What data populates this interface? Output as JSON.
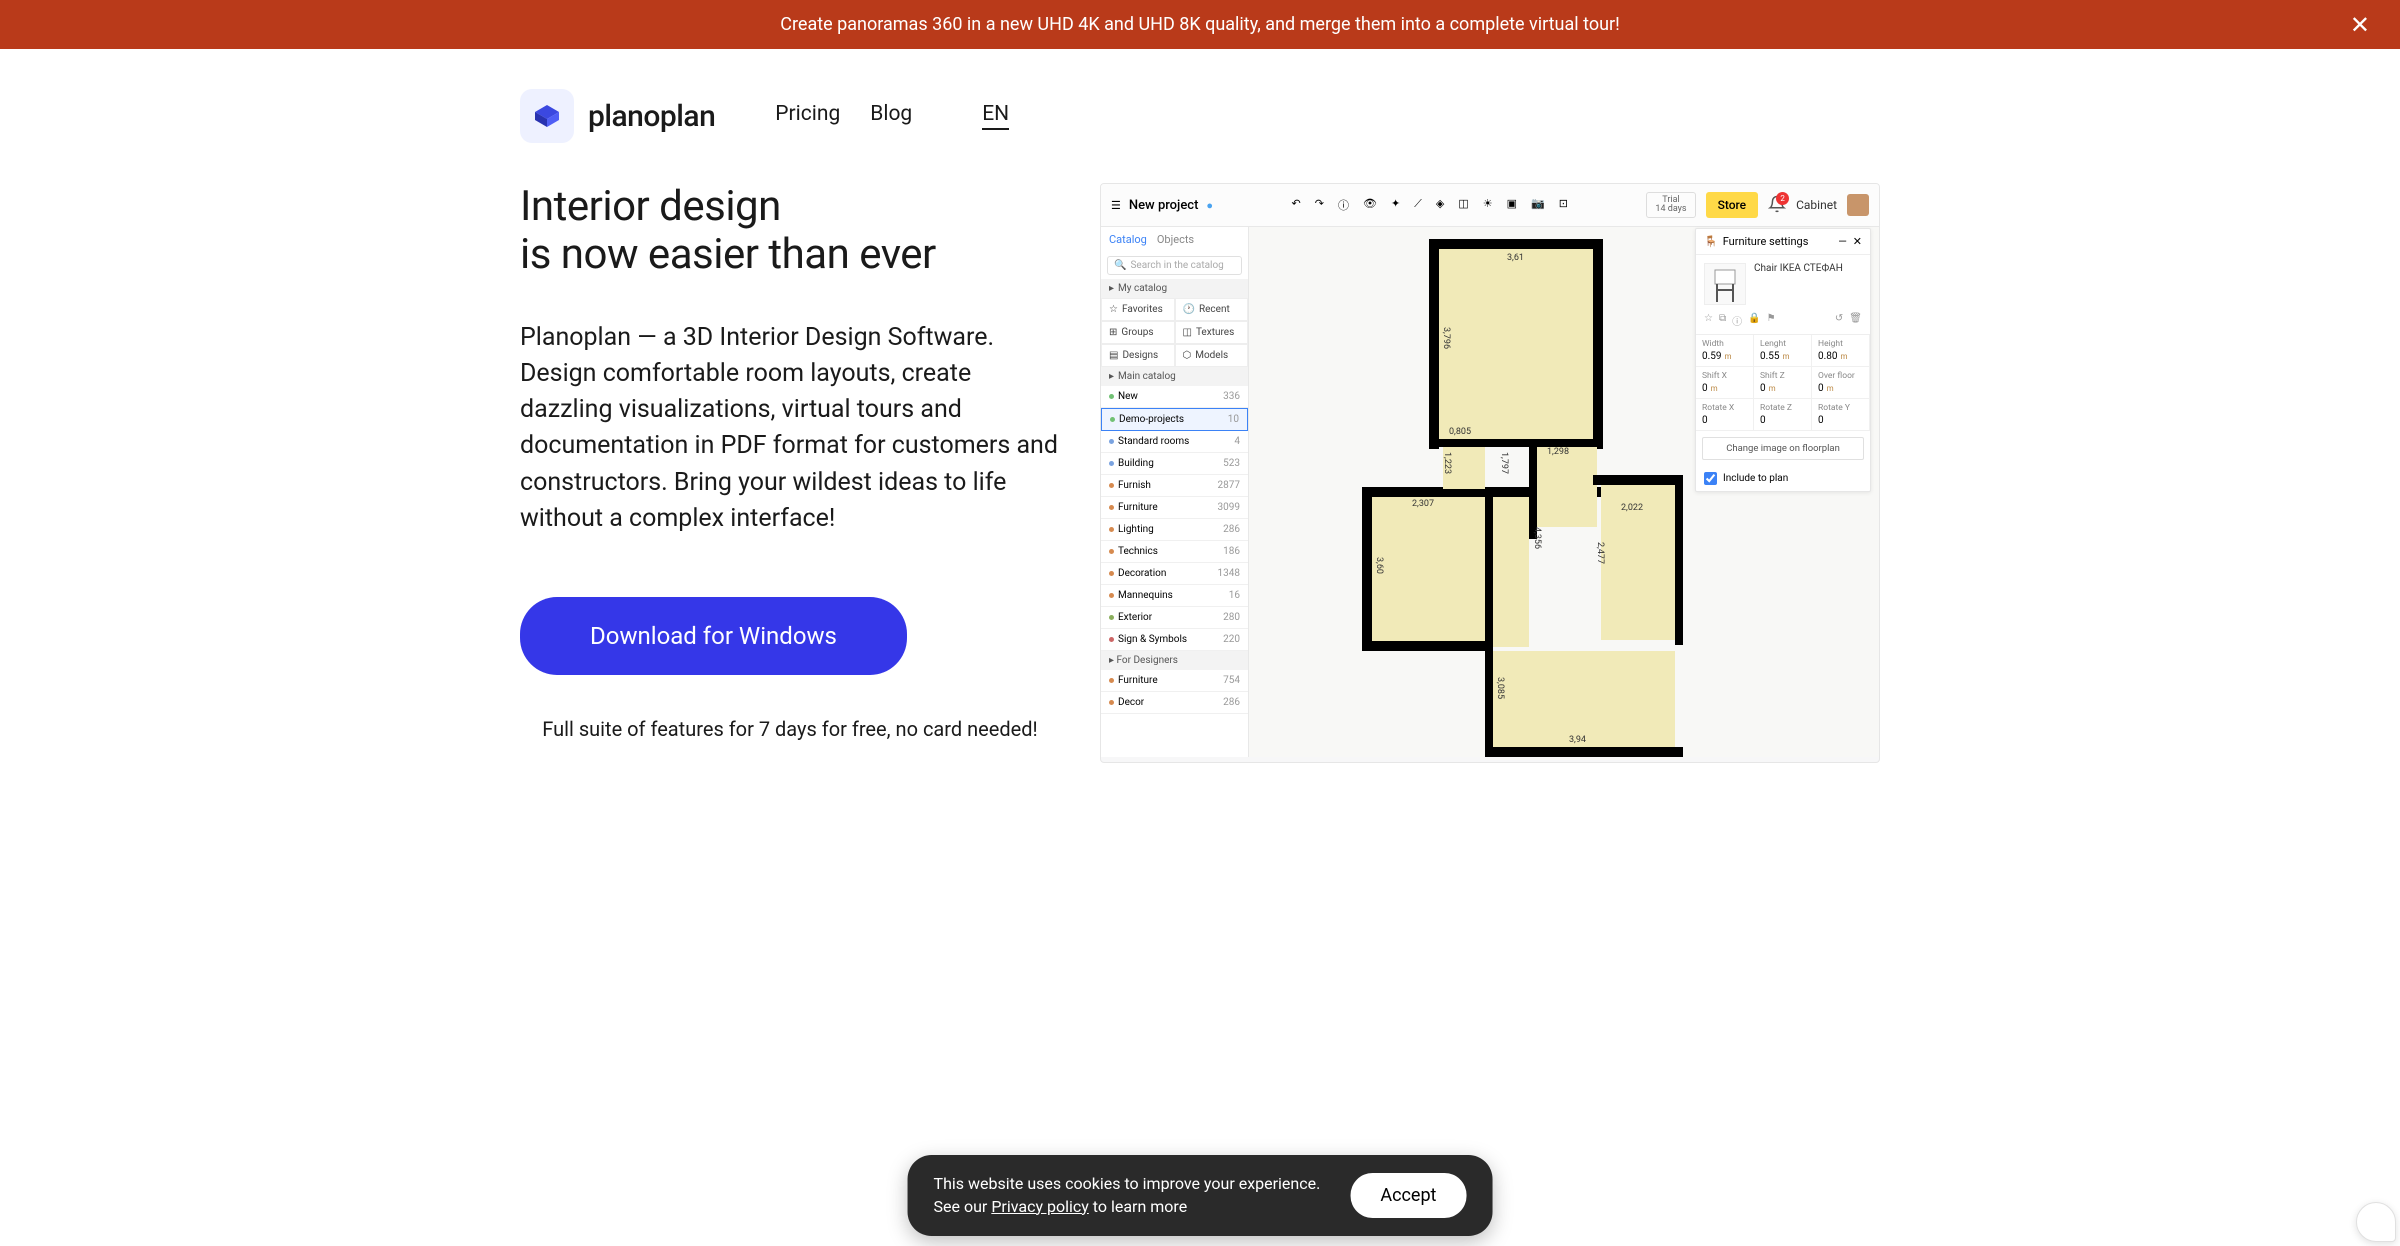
{
  "banner": {
    "text": "Create panoramas 360 in a new UHD 4K and UHD 8K quality, and merge them into a complete virtual tour!"
  },
  "nav": {
    "brand": "planoplan",
    "pricing": "Pricing",
    "blog": "Blog",
    "lang": "EN"
  },
  "hero": {
    "title_l1": "Interior design",
    "title_l2": "is now easier than ever",
    "desc": "Planoplan — a 3D Interior Design Software. Design comfortable room layouts, create dazzling visualizations, virtual tours and documentation in PDF format for customers and constructors. Bring your wildest ideas to life without a complex interface!",
    "cta": "Download for Windows",
    "note": "Full suite of features for 7 days for free, no card needed!"
  },
  "app": {
    "project": "New project",
    "trial_l1": "Trial",
    "trial_l2": "14 days",
    "store": "Store",
    "cabinet": "Cabinet",
    "bell_count": "2",
    "sidebar": {
      "tabs": {
        "catalog": "Catalog",
        "objects": "Objects"
      },
      "search_placeholder": "Search in the catalog",
      "my_catalog": "My catalog",
      "cells": {
        "favorites": "Favorites",
        "recent": "Recent",
        "groups": "Groups",
        "textures": "Textures",
        "designs": "Designs",
        "models": "Models"
      },
      "main_catalog": "Main catalog",
      "rows": [
        {
          "label": "New",
          "count": "336",
          "color": "#71c174"
        },
        {
          "label": "Demo-projects",
          "count": "10",
          "color": "#71c174",
          "selected": true
        },
        {
          "label": "Standard rooms",
          "count": "4",
          "color": "#7aa3e0"
        },
        {
          "label": "Building",
          "count": "523",
          "color": "#7aa3e0"
        },
        {
          "label": "Furnish",
          "count": "2877",
          "color": "#d68a4f"
        },
        {
          "label": "Furniture",
          "count": "3099",
          "color": "#d68a4f"
        },
        {
          "label": "Lighting",
          "count": "286",
          "color": "#d68a4f"
        },
        {
          "label": "Technics",
          "count": "186",
          "color": "#d68a4f"
        },
        {
          "label": "Decoration",
          "count": "1348",
          "color": "#d68a4f"
        },
        {
          "label": "Mannequins",
          "count": "16",
          "color": "#d68a4f"
        },
        {
          "label": "Exterior",
          "count": "280",
          "color": "#8aae5c"
        },
        {
          "label": "Sign & Symbols",
          "count": "220",
          "color": "#c66"
        },
        {
          "label": "For Designers",
          "count": "",
          "color": "#999",
          "section": true
        },
        {
          "label": "Furniture",
          "count": "754",
          "color": "#d68a4f"
        },
        {
          "label": "Decor",
          "count": "286",
          "color": "#d68a4f"
        }
      ]
    },
    "dims": {
      "d1": "3,61",
      "d2": "3,796",
      "d3": "0,805",
      "d4": "1,223",
      "d5": "1,797",
      "d6": "1,298",
      "d7": "2,307",
      "d8": "4,356",
      "d9": "2,022",
      "d10": "3,60",
      "d11": "2,477",
      "d12": "3,085",
      "d13": "3,94"
    },
    "rightpanel": {
      "title": "Furniture settings",
      "item": "Chair IKEA СТЕФАН",
      "props": {
        "width_l": "Width",
        "width_v": "0.59",
        "width_u": "m",
        "length_l": "Lenght",
        "length_v": "0.55",
        "length_u": "m",
        "height_l": "Height",
        "height_v": "0.80",
        "height_u": "m",
        "shiftx_l": "Shift X",
        "shiftx_v": "0",
        "shiftx_u": "m",
        "shiftz_l": "Shift Z",
        "shiftz_v": "0",
        "shiftz_u": "m",
        "overfloor_l": "Over floor",
        "overfloor_v": "0",
        "overfloor_u": "m",
        "rotx_l": "Rotate X",
        "rotx_v": "0",
        "rotz_l": "Rotate Z",
        "rotz_v": "0",
        "roty_l": "Rotate Y",
        "roty_v": "0"
      },
      "change_img": "Change image on floorplan",
      "include": "Include to plan"
    }
  },
  "cookie": {
    "line1": "This website uses cookies to improve your experience.",
    "line2a": "See our ",
    "link": "Privacy policy",
    "line2b": " to learn more",
    "accept": "Accept"
  }
}
